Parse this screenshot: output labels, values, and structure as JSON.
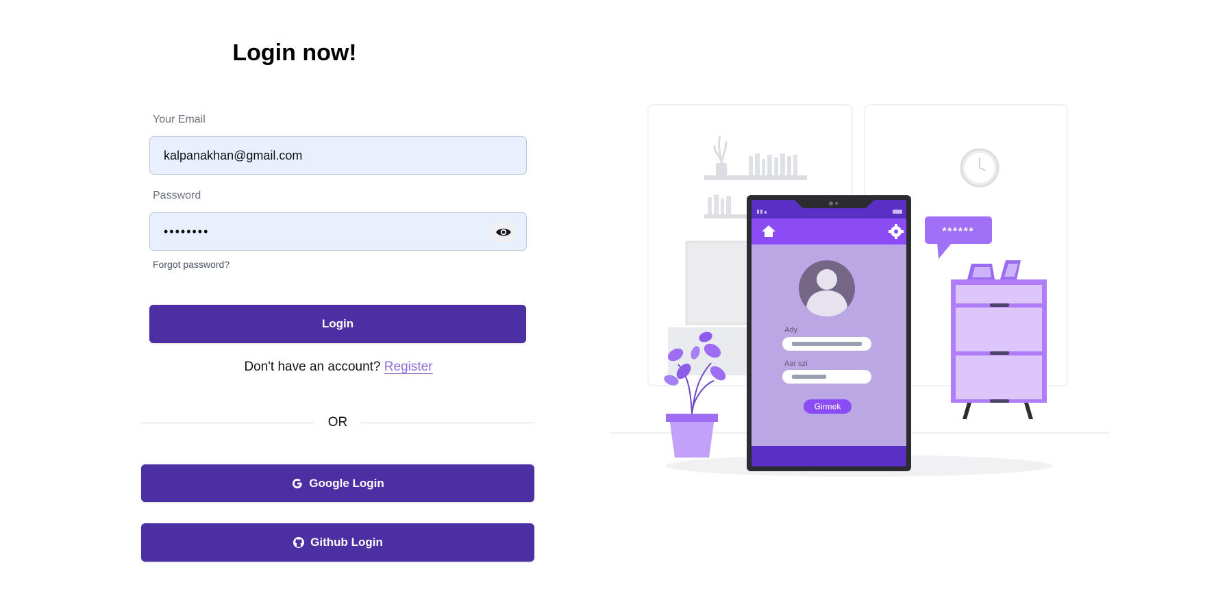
{
  "login": {
    "title": "Login now!",
    "email_label": "Your Email",
    "email_value": "kalpanakhan@gmail.com",
    "password_label": "Password",
    "password_value": "••••••••",
    "forgot_password": "Forgot password?",
    "login_button": "Login",
    "no_account_text": "Don't have an account?",
    "register_link": "Register",
    "or_text": "OR",
    "google_button": "Google Login",
    "github_button": "Github Login"
  },
  "illustration": {
    "username_label": "Ady",
    "password_label": "Aar szi",
    "submit_label": "Girmek",
    "password_bubble": "******"
  },
  "colors": {
    "primary": "#4c2fa3",
    "accent": "#8d6bd8",
    "input_bg": "#e8f0fe"
  },
  "icons": [
    "eye-icon",
    "google-icon",
    "github-icon",
    "home-icon",
    "gear-icon",
    "user-avatar-icon"
  ]
}
